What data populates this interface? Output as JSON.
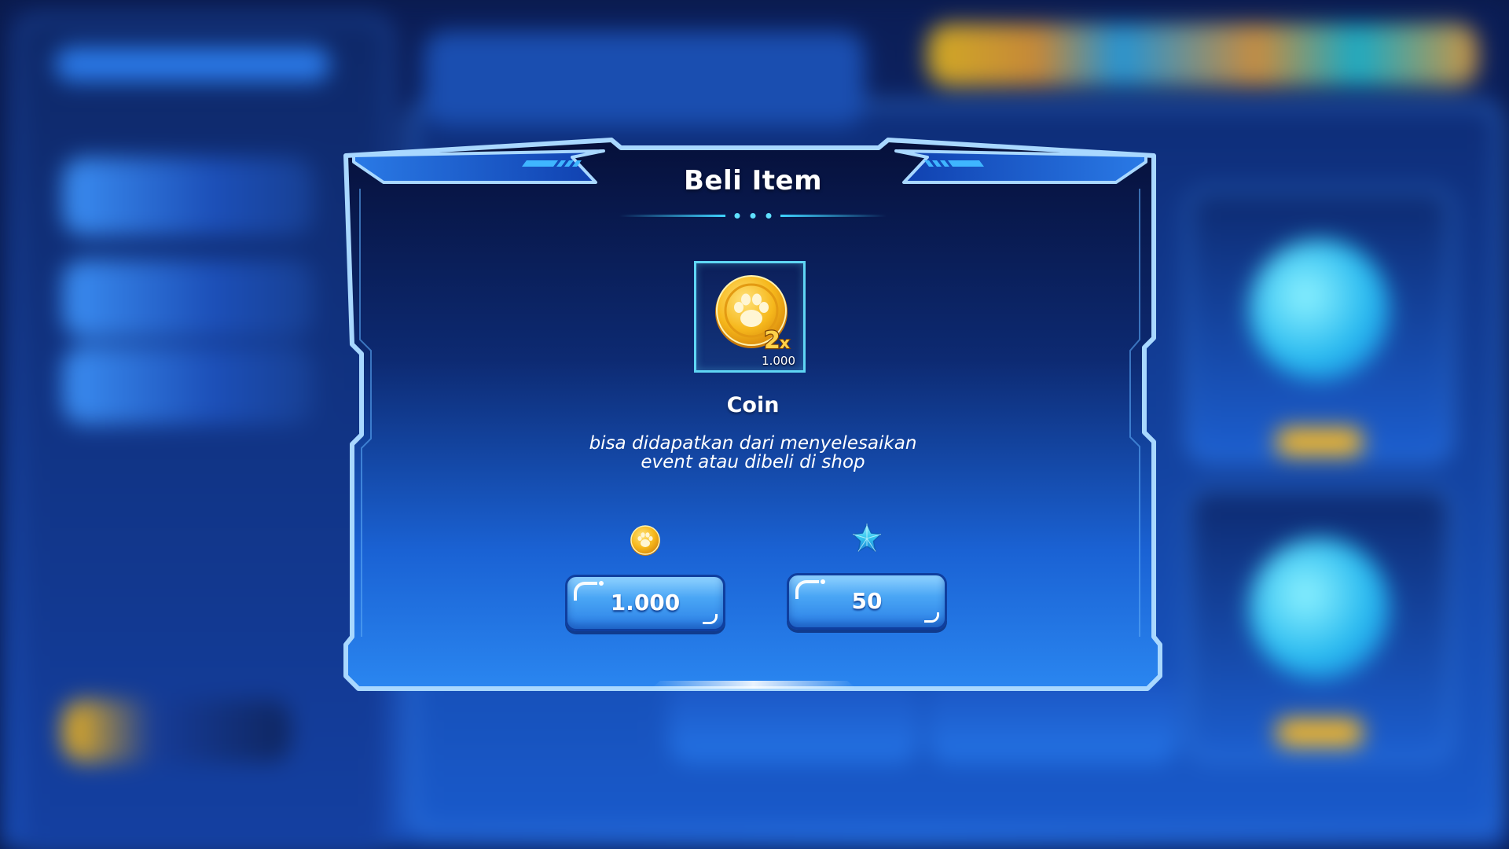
{
  "dialog": {
    "title": "Beli Item",
    "item": {
      "name": "Coin",
      "quantity": "1.000",
      "icon": "paw-coin-2x-icon",
      "description_line1": "bisa didapatkan dari menyelesaikan",
      "description_line2": "event atau dibeli di shop"
    },
    "price_options": [
      {
        "currency_icon": "paw-coin-icon",
        "label": "1.000"
      },
      {
        "currency_icon": "blue-star-gem-icon",
        "label": "50"
      }
    ]
  },
  "colors": {
    "frame_border": "#a9d8ff",
    "accent_blue": "#2a7ee6",
    "slot_border": "#5fd6f4",
    "coin_gold": "#f4b41a",
    "gem_cyan": "#35c6ef"
  }
}
